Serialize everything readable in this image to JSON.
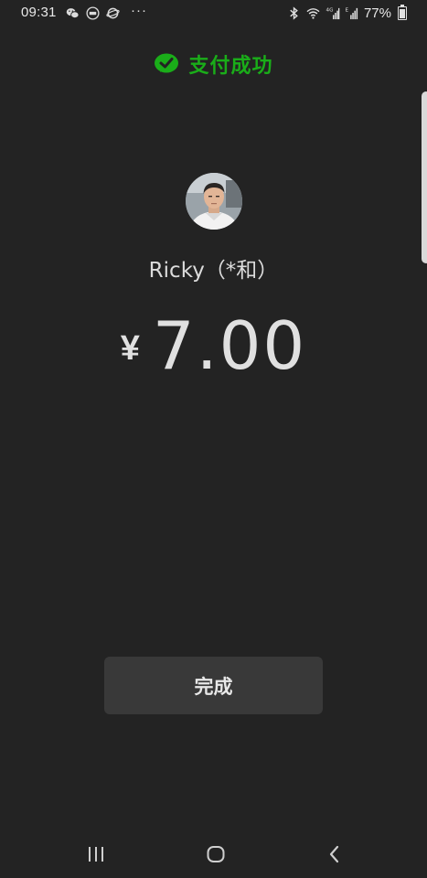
{
  "status_bar": {
    "time": "09:31",
    "more": "···",
    "battery_percent": "77%",
    "battery_level": 0.77
  },
  "header": {
    "title": "支付成功",
    "accent_color": "#1aad19"
  },
  "payee": {
    "name": "Ricky（*和）"
  },
  "payment": {
    "currency_symbol": "¥",
    "amount": "7.00"
  },
  "actions": {
    "done_label": "完成"
  },
  "nav_bar": {
    "icons": [
      "recent-apps-icon",
      "home-icon",
      "back-icon"
    ]
  }
}
